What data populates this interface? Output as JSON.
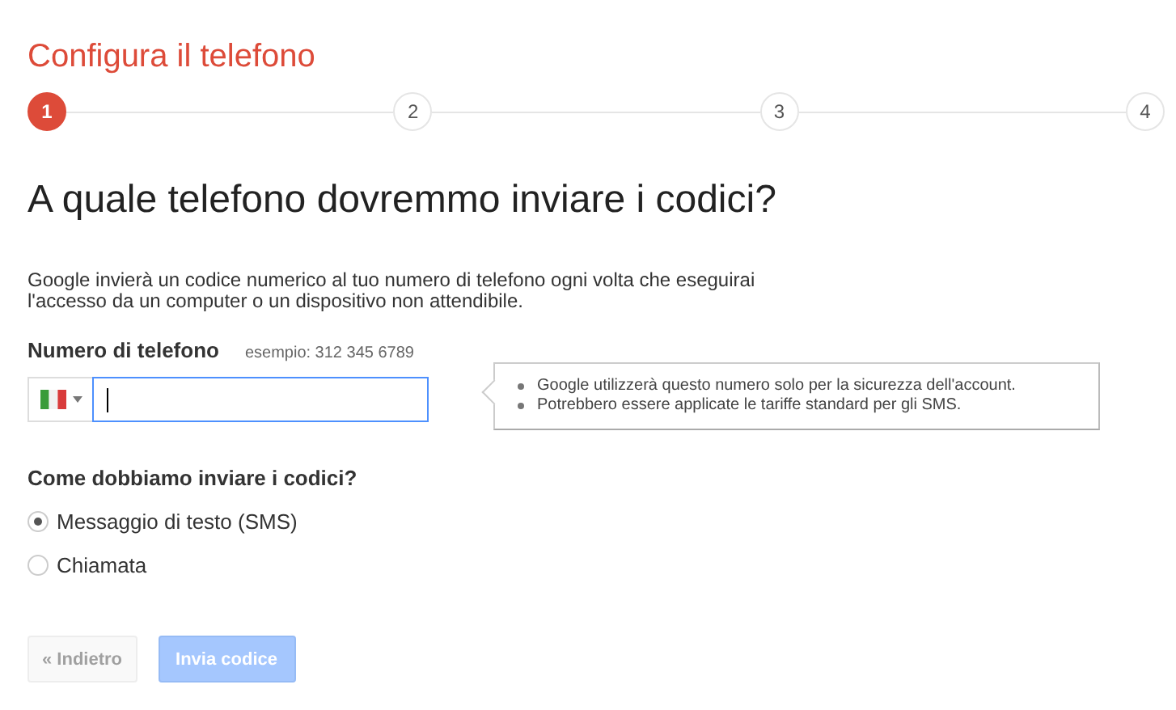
{
  "title": "Configura il telefono",
  "steps": [
    {
      "label": "1",
      "selected": true
    },
    {
      "label": "2",
      "selected": false
    },
    {
      "label": "3",
      "selected": false
    },
    {
      "label": "4",
      "selected": false
    }
  ],
  "heading": "A quale telefono dovremmo inviare i codici?",
  "description": "Google invierà un codice numerico al tuo numero di telefono ogni volta che eseguirai l'accesso da un computer o un dispositivo non attendibile.",
  "phone_field": {
    "label": "Numero di telefono",
    "example": "esempio: 312 345 6789"
  },
  "tooltip": [
    "Google utilizzerà questo numero solo per la sicurezza dell'account.",
    "Potrebbero essere applicate le tariffe standard per gli SMS."
  ],
  "method_question": "Come dobbiamo inviare i codici?",
  "methods": [
    {
      "label": "Messaggio di testo (SMS)",
      "selected": true
    },
    {
      "label": "Chiamata",
      "selected": false
    }
  ],
  "buttons": [
    {
      "label": "« Indietro",
      "kind": "secondary",
      "disabled": true
    },
    {
      "label": "Invia codice",
      "kind": "primary",
      "disabled": true
    }
  ]
}
